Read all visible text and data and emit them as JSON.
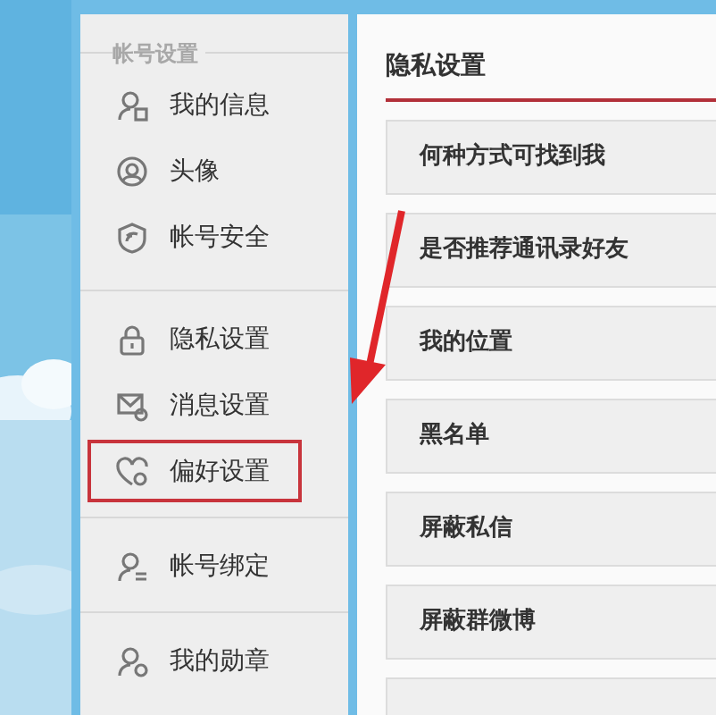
{
  "sidebar": {
    "sections": [
      {
        "heading": "帐号设置",
        "items": [
          {
            "label": "我的信息",
            "selected": false
          },
          {
            "label": "头像",
            "selected": false
          },
          {
            "label": "帐号安全",
            "selected": false
          }
        ]
      },
      {
        "items": [
          {
            "label": "隐私设置",
            "selected": false
          },
          {
            "label": "消息设置",
            "selected": false
          },
          {
            "label": "偏好设置",
            "selected": true
          }
        ]
      },
      {
        "items": [
          {
            "label": "帐号绑定",
            "selected": false
          }
        ]
      },
      {
        "items": [
          {
            "label": "我的勋章",
            "selected": false
          }
        ]
      }
    ]
  },
  "content": {
    "title": "隐私设置",
    "rows": [
      {
        "label": "何种方式可找到我"
      },
      {
        "label": "是否推荐通讯录好友"
      },
      {
        "label": "我的位置"
      },
      {
        "label": "黑名单"
      },
      {
        "label": "屏蔽私信"
      },
      {
        "label": "屏蔽群微博"
      },
      {}
    ]
  }
}
